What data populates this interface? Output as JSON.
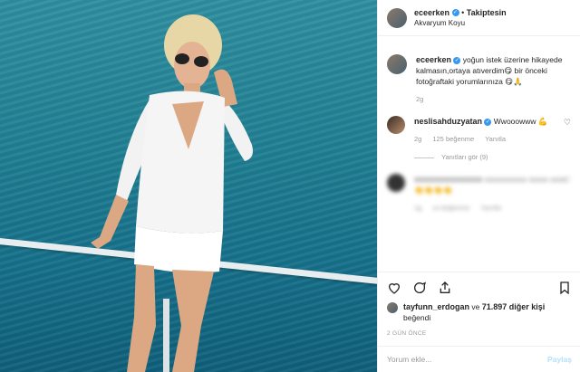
{
  "post": {
    "username": "eceerken",
    "follow_label": "Takiptesin",
    "separator": "•",
    "location": "Akvaryum Koyu"
  },
  "caption": {
    "username": "eceerken",
    "text": "yoğun istek üzerine hikayede kalmasın,ortaya atıverdim😋 bir önceki fotoğraftaki yorumlarınıza 😋🙏",
    "time": "2g"
  },
  "comments": [
    {
      "username": "neslisahduzyatan",
      "text": "Wwooowww 💪",
      "time": "2g",
      "likes": "125 beğenme",
      "reply_label": "Yanıtla",
      "view_replies": "Yanıtları gör (9)"
    },
    {
      "username": "xxxxxxxxxxxxxxx",
      "text": "xxxxxxxxxxx xxxxx xxxx 👏👏👏👏",
      "time": "1g",
      "likes": "xx beğenme",
      "reply_label": "Yanıtla"
    }
  ],
  "actions": {
    "liked_by_user": "tayfunn_erdogan",
    "liked_and": "ve",
    "liked_count": "71.897 diğer kişi",
    "liked_suffix": "beğendi",
    "date": "2 GÜN ÖNCE"
  },
  "comment_box": {
    "placeholder": "Yorum ekle...",
    "post_label": "Paylaş"
  },
  "icons": {
    "like": "heart-icon",
    "comment": "comment-icon",
    "share": "share-icon",
    "save": "bookmark-icon"
  },
  "colors": {
    "verified": "#3897f0",
    "muted": "#999999",
    "text": "#262626"
  }
}
